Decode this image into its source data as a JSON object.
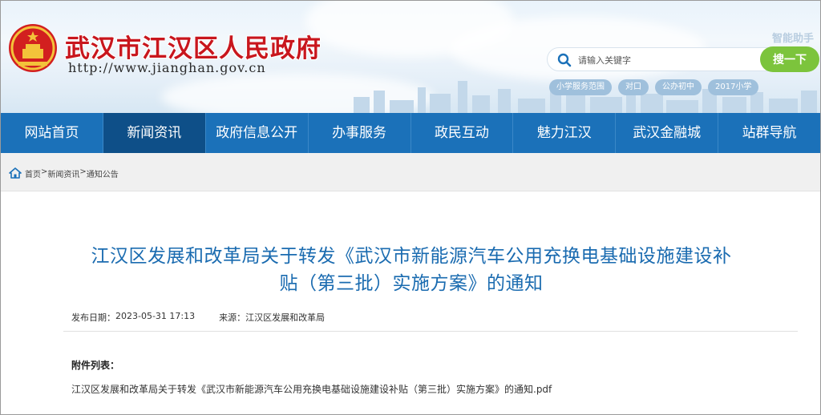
{
  "header": {
    "site_title": "武汉市江汉区人民政府",
    "site_url": "http://www.jianghan.gov.cn",
    "ai_assistant": "智能助手",
    "search": {
      "placeholder": "请输入关键字",
      "button_label": "搜一下"
    },
    "hot_tags": [
      "小学服务范围",
      "对口",
      "公办初中",
      "2017小学"
    ]
  },
  "nav": {
    "items": [
      "网站首页",
      "新闻资讯",
      "政府信息公开",
      "办事服务",
      "政民互动",
      "魅力江汉",
      "武汉金融城",
      "站群导航"
    ],
    "active_index": 1
  },
  "breadcrumb": [
    "首页",
    ">",
    "新闻资讯",
    ">",
    "通知公告"
  ],
  "article": {
    "title_line1": "江汉区发展和改革局关于转发《武汉市新能源汽车公用充换电基础设施建设补",
    "title_line2": "贴（第三批）实施方案》的通知",
    "publish_label": "发布日期：",
    "publish_date": "2023-05-31 17:13",
    "source_label": "来源：",
    "source": "江汉区发展和改革局",
    "attachments_heading": "附件列表：",
    "attachment_file": "江汉区发展和改革局关于转发《武汉市新能源汽车公用充换电基础设施建设补贴（第三批）实施方案》的通知.pdf"
  },
  "colors": {
    "brand_red": "#c8161d",
    "nav_blue": "#1b71b9",
    "nav_active": "#0e4f88",
    "title_blue": "#1a6bb0",
    "search_green": "#7cc43c"
  },
  "icons": [
    "national-emblem-icon",
    "search-icon",
    "home-icon"
  ]
}
